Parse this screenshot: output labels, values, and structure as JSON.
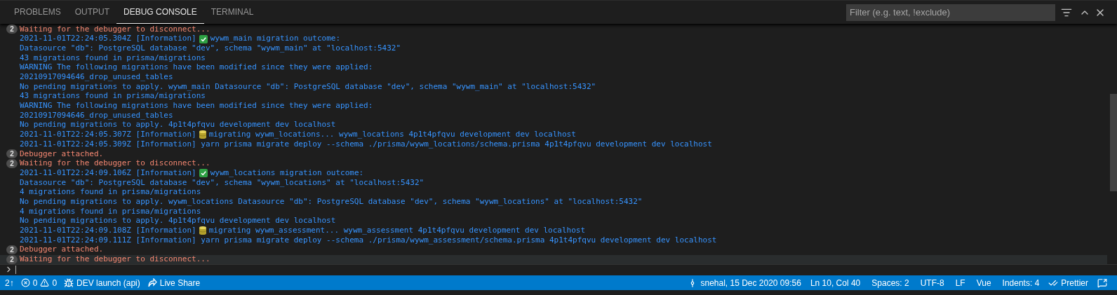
{
  "tabs": [
    {
      "label": "PROBLEMS",
      "selected": false
    },
    {
      "label": "OUTPUT",
      "selected": false
    },
    {
      "label": "DEBUG CONSOLE",
      "selected": true
    },
    {
      "label": "TERMINAL",
      "selected": false
    }
  ],
  "filter": {
    "placeholder": "Filter (e.g. text, !exclude)"
  },
  "console": [
    {
      "kind": "error",
      "count": "2",
      "text": "Waiting for the debugger to disconnect...",
      "selected": false
    },
    {
      "kind": "outcome",
      "prefix": "2021-11-01T22:24:05.304Z [Information]",
      "text": "wywm_main migration outcome:",
      "selected": false
    },
    {
      "kind": "info",
      "text": "Datasource \"db\": PostgreSQL database \"dev\", schema \"wywm_main\" at \"localhost:5432\"",
      "selected": false
    },
    {
      "kind": "info",
      "text": "43 migrations found in prisma/migrations",
      "selected": false
    },
    {
      "kind": "info",
      "text": "WARNING The following migrations have been modified since they were applied:",
      "selected": false
    },
    {
      "kind": "info",
      "text": "20210917094646_drop_unused_tables",
      "selected": false
    },
    {
      "kind": "info",
      "text": "No pending migrations to apply. wywm_main Datasource \"db\": PostgreSQL database \"dev\", schema \"wywm_main\" at \"localhost:5432\"",
      "selected": false
    },
    {
      "kind": "info",
      "text": "43 migrations found in prisma/migrations",
      "selected": false
    },
    {
      "kind": "info",
      "text": "WARNING The following migrations have been modified since they were applied:",
      "selected": false
    },
    {
      "kind": "info",
      "text": "20210917094646_drop_unused_tables",
      "selected": false
    },
    {
      "kind": "info",
      "text": "No pending migrations to apply. 4p1t4pfqvu development dev localhost",
      "selected": false
    },
    {
      "kind": "migrating",
      "prefix": "2021-11-01T22:24:05.307Z [Information]",
      "text": "migrating wywm_locations... wywm_locations 4p1t4pfqvu development dev localhost",
      "selected": false
    },
    {
      "kind": "info",
      "text": "2021-11-01T22:24:05.309Z [Information] yarn prisma migrate deploy --schema ./prisma/wywm_locations/schema.prisma 4p1t4pfqvu development dev localhost",
      "selected": false
    },
    {
      "kind": "error",
      "count": "2",
      "text": "Debugger attached.",
      "selected": false
    },
    {
      "kind": "error",
      "count": "2",
      "text": "Waiting for the debugger to disconnect...",
      "selected": false
    },
    {
      "kind": "outcome",
      "prefix": "2021-11-01T22:24:09.106Z [Information]",
      "text": "wywm_locations migration outcome:",
      "selected": false
    },
    {
      "kind": "info",
      "text": "Datasource \"db\": PostgreSQL database \"dev\", schema \"wywm_locations\" at \"localhost:5432\"",
      "selected": false
    },
    {
      "kind": "info",
      "text": "4 migrations found in prisma/migrations",
      "selected": false
    },
    {
      "kind": "info",
      "text": "No pending migrations to apply. wywm_locations Datasource \"db\": PostgreSQL database \"dev\", schema \"wywm_locations\" at \"localhost:5432\"",
      "selected": false
    },
    {
      "kind": "info",
      "text": "4 migrations found in prisma/migrations",
      "selected": false
    },
    {
      "kind": "info",
      "text": "No pending migrations to apply. 4p1t4pfqvu development dev localhost",
      "selected": false
    },
    {
      "kind": "migrating",
      "prefix": "2021-11-01T22:24:09.108Z [Information]",
      "text": "migrating wywm_assessment... wywm_assessment 4p1t4pfqvu development dev localhost",
      "selected": false
    },
    {
      "kind": "info",
      "text": "2021-11-01T22:24:09.111Z [Information] yarn prisma migrate deploy --schema ./prisma/wywm_assessment/schema.prisma 4p1t4pfqvu development dev localhost",
      "selected": false
    },
    {
      "kind": "error",
      "count": "2",
      "text": "Debugger attached.",
      "selected": false
    },
    {
      "kind": "error",
      "count": "2",
      "text": "Waiting for the debugger to disconnect...",
      "selected": true
    }
  ],
  "status_bar": {
    "left": [
      {
        "kind": "sync",
        "text": "2↑"
      },
      {
        "kind": "problems",
        "errors": "0",
        "warnings": "0"
      },
      {
        "kind": "debug",
        "text": "DEV launch (api)"
      },
      {
        "kind": "share",
        "text": "Live Share"
      }
    ],
    "right": [
      {
        "kind": "commit",
        "text": "snehal, 15 Dec 2020 09:56"
      },
      {
        "kind": "plain",
        "text": "Ln 10, Col 40"
      },
      {
        "kind": "plain",
        "text": "Spaces: 2"
      },
      {
        "kind": "plain",
        "text": "UTF-8"
      },
      {
        "kind": "plain",
        "text": "LF"
      },
      {
        "kind": "plain",
        "text": "Vue"
      },
      {
        "kind": "plain",
        "text": "Indents: 4"
      },
      {
        "kind": "prettier",
        "text": "Prettier"
      },
      {
        "kind": "feedback"
      }
    ]
  }
}
